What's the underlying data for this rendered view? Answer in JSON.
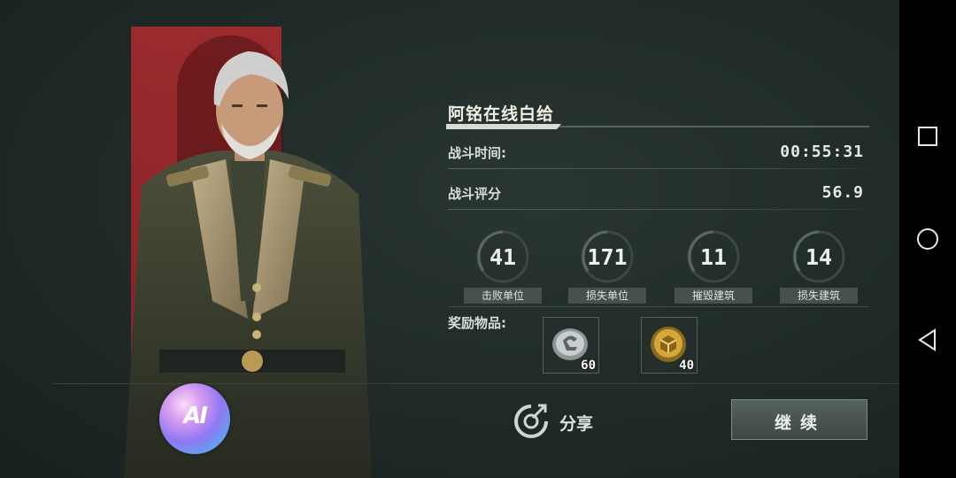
{
  "player": {
    "name": "阿铭在线白给"
  },
  "stats": [
    {
      "label": "战斗时间:",
      "value": "00:55:31"
    },
    {
      "label": "战斗评分",
      "value": "56.9"
    }
  ],
  "gauges": [
    {
      "value": "41",
      "label": "击败单位"
    },
    {
      "value": "171",
      "label": "损失单位"
    },
    {
      "value": "11",
      "label": "摧毁建筑"
    },
    {
      "value": "14",
      "label": "损失建筑"
    }
  ],
  "rewards": {
    "label": "奖励物品:",
    "items": [
      {
        "icon": "silver-coin-icon",
        "count": "60"
      },
      {
        "icon": "gold-crate-icon",
        "count": "40"
      }
    ]
  },
  "actions": {
    "ai_label": "AI",
    "share_label": "分享",
    "continue_label": "继续"
  },
  "colors": {
    "banner": "#a52a2f",
    "panel_bg": "#1f2a28",
    "accent": "#8f78f2"
  }
}
